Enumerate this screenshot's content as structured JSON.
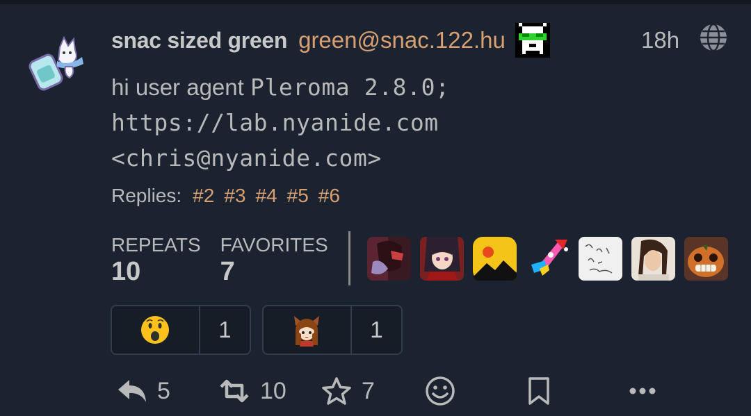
{
  "post": {
    "author_name": "snac sized green",
    "author_handle": "green@snac.122.hu",
    "time": "18h",
    "content": {
      "prefix": "hi user agent",
      "line1_mono": "Pleroma 2.8.0;",
      "line2_mono": "https://lab.nyanide.com",
      "line3_mono": "<chris@nyanide.com>"
    },
    "replies_label": "Replies:",
    "replies": [
      "#2",
      "#3",
      "#4",
      "#5",
      "#6"
    ]
  },
  "stats": {
    "repeats_label": "REPEATS",
    "repeats_value": "10",
    "favorites_label": "FAVORITES",
    "favorites_value": "7"
  },
  "reactions": [
    {
      "emoji": "hushed-face",
      "count": "1"
    },
    {
      "emoji": "custom-anime-girl",
      "count": "1"
    }
  ],
  "actions": {
    "reply_count": "5",
    "repeat_count": "10",
    "favorite_count": "7"
  },
  "icons": [
    "reply-icon",
    "repeat-icon",
    "star-icon",
    "smile-icon",
    "bookmark-icon",
    "more-icon",
    "globe-icon"
  ],
  "colors": {
    "background": "#1c2330",
    "text": "#b9b9ba",
    "link": "#d8a070",
    "divider": "#8a8a8b"
  }
}
